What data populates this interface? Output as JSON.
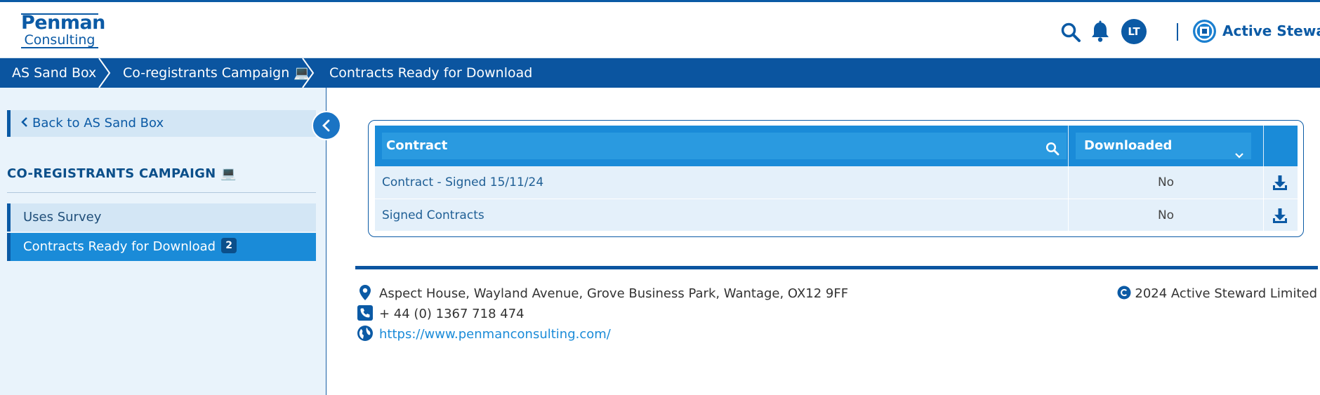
{
  "header": {
    "logo_line1": "Penman",
    "logo_line2": "Consulting",
    "avatar_initials": "LT",
    "brand_name": "Active Steward"
  },
  "breadcrumb": {
    "items": [
      {
        "label": "AS Sand Box"
      },
      {
        "label": "Co-registrants Campaign 💻"
      },
      {
        "label": "Contracts Ready for Download"
      }
    ]
  },
  "sidebar": {
    "back_label": "Back to AS Sand Box",
    "heading": "CO-REGISTRANTS CAMPAIGN 💻",
    "items": [
      {
        "label": "Uses Survey"
      },
      {
        "label": "Contracts Ready for Download",
        "badge": "2"
      }
    ]
  },
  "table": {
    "col_contract": "Contract",
    "col_downloaded": "Downloaded",
    "rows": [
      {
        "contract": "Contract - Signed 15/11/24",
        "downloaded": "No"
      },
      {
        "contract": "Signed Contracts",
        "downloaded": "No"
      }
    ]
  },
  "footer": {
    "address": "Aspect House, Wayland Avenue, Grove Business Park, Wantage, OX12 9FF",
    "phone": "+ 44 (0) 1367 718 474",
    "website": "https://www.penmanconsulting.com/",
    "copyright": "2024 Active Steward Limited"
  },
  "colors": {
    "primary": "#0b5aa5",
    "accent": "#1a8bd8",
    "sidebar_bg": "#e9f3fb"
  }
}
